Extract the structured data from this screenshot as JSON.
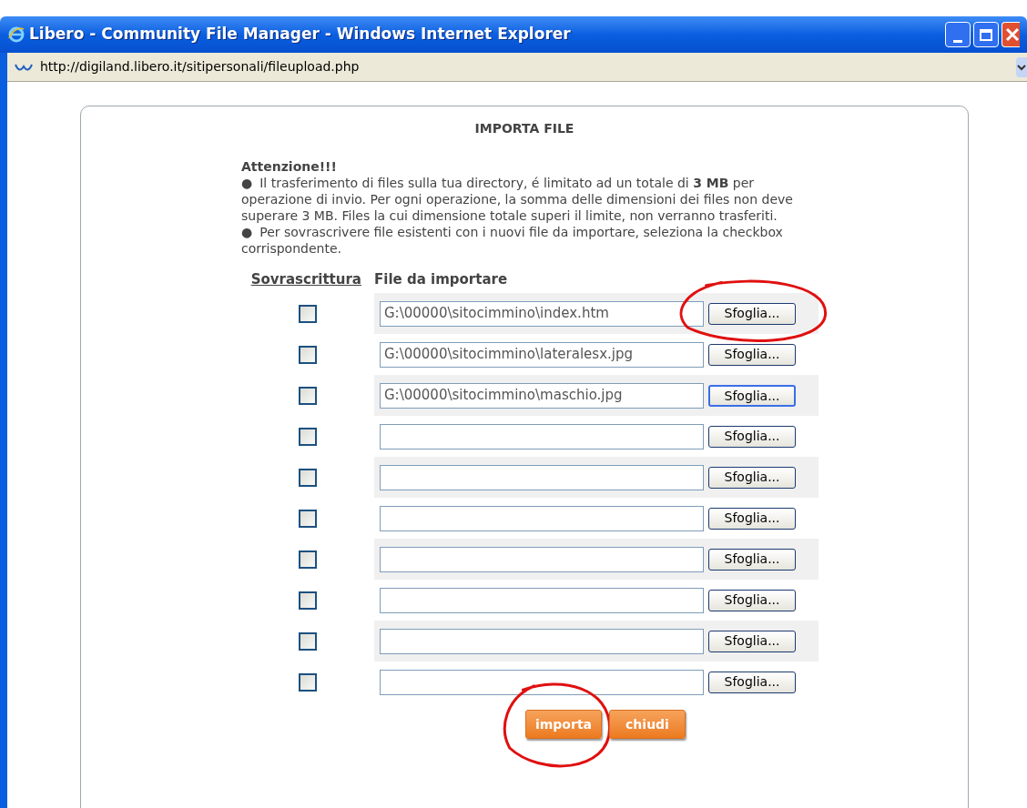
{
  "window": {
    "title": "Libero - Community File Manager - Windows Internet Explorer"
  },
  "address_bar": {
    "url": "http://digiland.libero.it/sitipersonali/fileupload.php"
  },
  "dialog": {
    "title": "IMPORTA FILE",
    "warning_title": "Attenzione!!!",
    "notes": [
      "Il trasferimento di files sulla tua directory, é limitato ad un totale di **3 MB** per operazione di invio. Per ogni operazione, la somma delle dimensioni dei files non deve superare 3 MB. Files la cui dimensione totale superi il limite, non verranno trasferiti.",
      "Per sovrascrivere file esistenti con i nuovi file da importare, seleziona la checkbox corrispondente."
    ],
    "bullet": "●",
    "columns": [
      "Sovrascrittura",
      "File da importare"
    ],
    "rows": [
      {
        "checked": false,
        "value": "G:\\00000\\sitocimmino\\index.htm",
        "button": "Sfoglia...",
        "focused": false,
        "circled": true
      },
      {
        "checked": false,
        "value": "G:\\00000\\sitocimmino\\lateralesx.jpg",
        "button": "Sfoglia...",
        "focused": false,
        "circled": false
      },
      {
        "checked": false,
        "value": "G:\\00000\\sitocimmino\\maschio.jpg",
        "button": "Sfoglia...",
        "focused": true,
        "circled": false
      },
      {
        "checked": false,
        "value": "",
        "button": "Sfoglia...",
        "focused": false,
        "circled": false
      },
      {
        "checked": false,
        "value": "",
        "button": "Sfoglia...",
        "focused": false,
        "circled": false
      },
      {
        "checked": false,
        "value": "",
        "button": "Sfoglia...",
        "focused": false,
        "circled": false
      },
      {
        "checked": false,
        "value": "",
        "button": "Sfoglia...",
        "focused": false,
        "circled": false
      },
      {
        "checked": false,
        "value": "",
        "button": "Sfoglia...",
        "focused": false,
        "circled": false
      },
      {
        "checked": false,
        "value": "",
        "button": "Sfoglia...",
        "focused": false,
        "circled": false
      },
      {
        "checked": false,
        "value": "",
        "button": "Sfoglia...",
        "focused": false,
        "circled": false
      }
    ],
    "actions": [
      {
        "label": "importa",
        "circled": true
      },
      {
        "label": "chiudi",
        "circled": false
      }
    ]
  }
}
